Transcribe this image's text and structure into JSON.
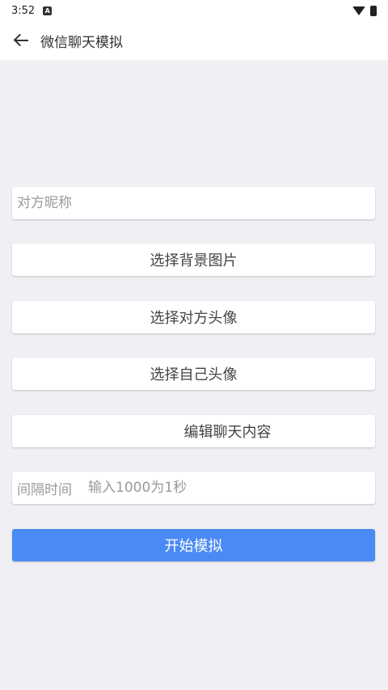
{
  "status_bar": {
    "time": "3:52",
    "notification_letter": "A"
  },
  "app_bar": {
    "title": "微信聊天模拟"
  },
  "form": {
    "nickname_placeholder": "对方昵称",
    "choose_background_label": "选择背景图片",
    "choose_other_avatar_label": "选择对方头像",
    "choose_own_avatar_label": "选择自己头像",
    "edit_chat_label": "编辑聊天内容",
    "interval_label": "间隔时间",
    "interval_placeholder": "输入1000为1秒",
    "start_label": "开始模拟"
  },
  "colors": {
    "primary": "#4a8af4",
    "background": "#efeff4"
  }
}
